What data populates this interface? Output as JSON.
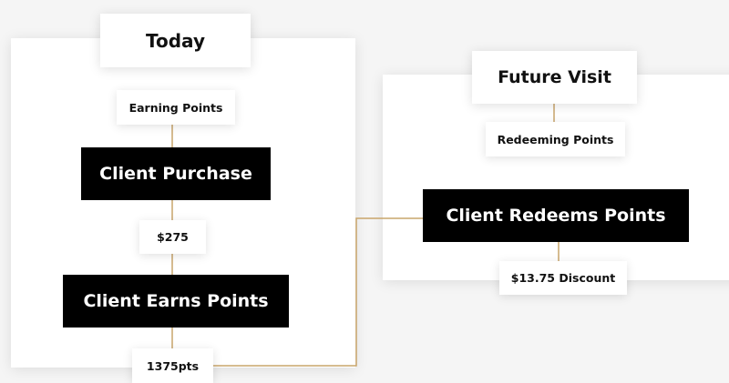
{
  "colors": {
    "connector": "#C9A56B",
    "block_background": "#000000",
    "block_text": "#FFFFFF",
    "label_background": "#FFFFFF",
    "canvas_background": "#F5F5F5"
  },
  "today": {
    "heading": "Today",
    "earning_label": "Earning Points",
    "purchase_block": "Client Purchase",
    "amount_label": "$275",
    "earns_block": "Client Earns Points",
    "points_label": "1375pts"
  },
  "future": {
    "heading": "Future Visit",
    "redeeming_label": "Redeeming Points",
    "redeems_block": "Client Redeems Points",
    "discount_label": "$13.75 Discount"
  }
}
